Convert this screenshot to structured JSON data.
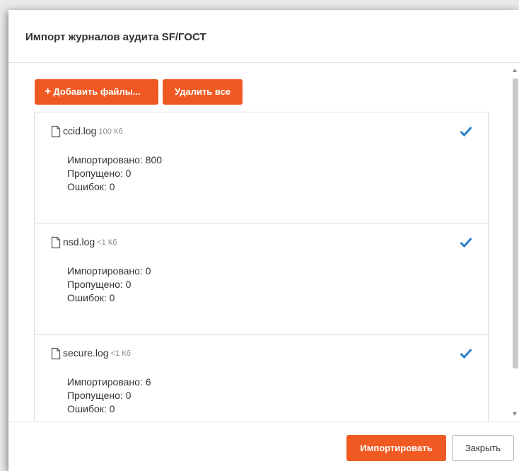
{
  "dialog": {
    "title": "Импорт журналов аудита SF/ГОСТ"
  },
  "toolbar": {
    "add_files_label": "Добавить файлы...",
    "delete_all_label": "Удалить все"
  },
  "files": [
    {
      "name": "ccid.log",
      "size": "100 Кб",
      "imported_label": "Импортировано: 800",
      "skipped_label": "Пропущено: 0",
      "errors_label": "Ошибок: 0"
    },
    {
      "name": "nsd.log",
      "size": "<1 Кб",
      "imported_label": "Импортировано: 0",
      "skipped_label": "Пропущено: 0",
      "errors_label": "Ошибок: 0"
    },
    {
      "name": "secure.log",
      "size": "<1 Кб",
      "imported_label": "Импортировано: 6",
      "skipped_label": "Пропущено: 0",
      "errors_label": "Ошибок: 0"
    }
  ],
  "footer": {
    "import_label": "Импортировать",
    "close_label": "Закрыть"
  },
  "colors": {
    "accent": "#f05a22",
    "check": "#2a7fc9"
  }
}
